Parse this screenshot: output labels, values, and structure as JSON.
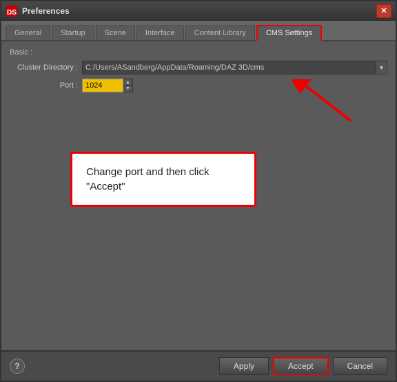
{
  "window": {
    "title": "Preferences",
    "icon": "DS"
  },
  "tabs": {
    "items": [
      {
        "label": "General",
        "active": false
      },
      {
        "label": "Startup",
        "active": false
      },
      {
        "label": "Scene",
        "active": false
      },
      {
        "label": "Interface",
        "active": false
      },
      {
        "label": "Content Library",
        "active": false
      },
      {
        "label": "CMS Settings",
        "active": true
      }
    ]
  },
  "section": {
    "label": "Basic :"
  },
  "fields": {
    "cluster_directory": {
      "label": "Cluster Directory :",
      "value": "C:/Users/ASandberg/AppData/Roaming/DAZ 3D/cms"
    },
    "port": {
      "label": "Port :",
      "value": "1024"
    }
  },
  "tooltip": {
    "text": "Change port and then click\n\"Accept\""
  },
  "buttons": {
    "apply": "Apply",
    "accept": "Accept",
    "cancel": "Cancel"
  },
  "help": "?"
}
